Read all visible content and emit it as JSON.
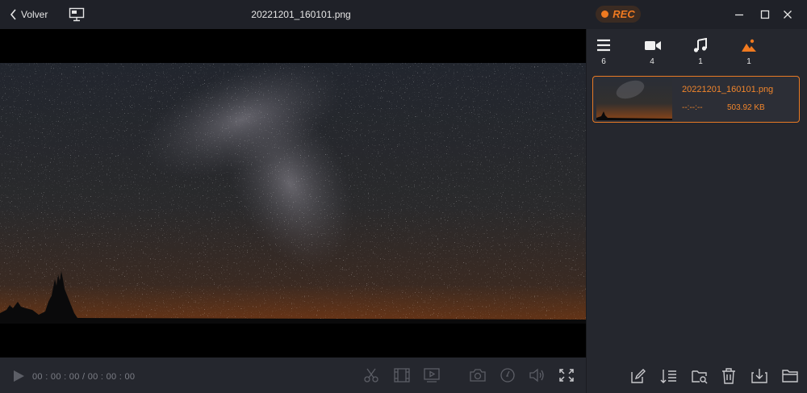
{
  "titlebar": {
    "back_label": "Volver",
    "file_title": "20221201_160101.png",
    "rec_label": "REC",
    "colors": {
      "accent": "#f07a20",
      "bg": "#1f2128"
    }
  },
  "player": {
    "time_display": "00 : 00 : 00 / 00 : 00 : 00"
  },
  "categories": [
    {
      "icon": "list-icon",
      "count": "6",
      "active": false
    },
    {
      "icon": "video-camera-icon",
      "count": "4",
      "active": false
    },
    {
      "icon": "music-note-icon",
      "count": "1",
      "active": false
    },
    {
      "icon": "image-icon",
      "count": "1",
      "active": true
    }
  ],
  "files": [
    {
      "name": "20221201_160101.png",
      "duration": "--:--:--",
      "size": "503.92 KB",
      "selected": true
    }
  ]
}
